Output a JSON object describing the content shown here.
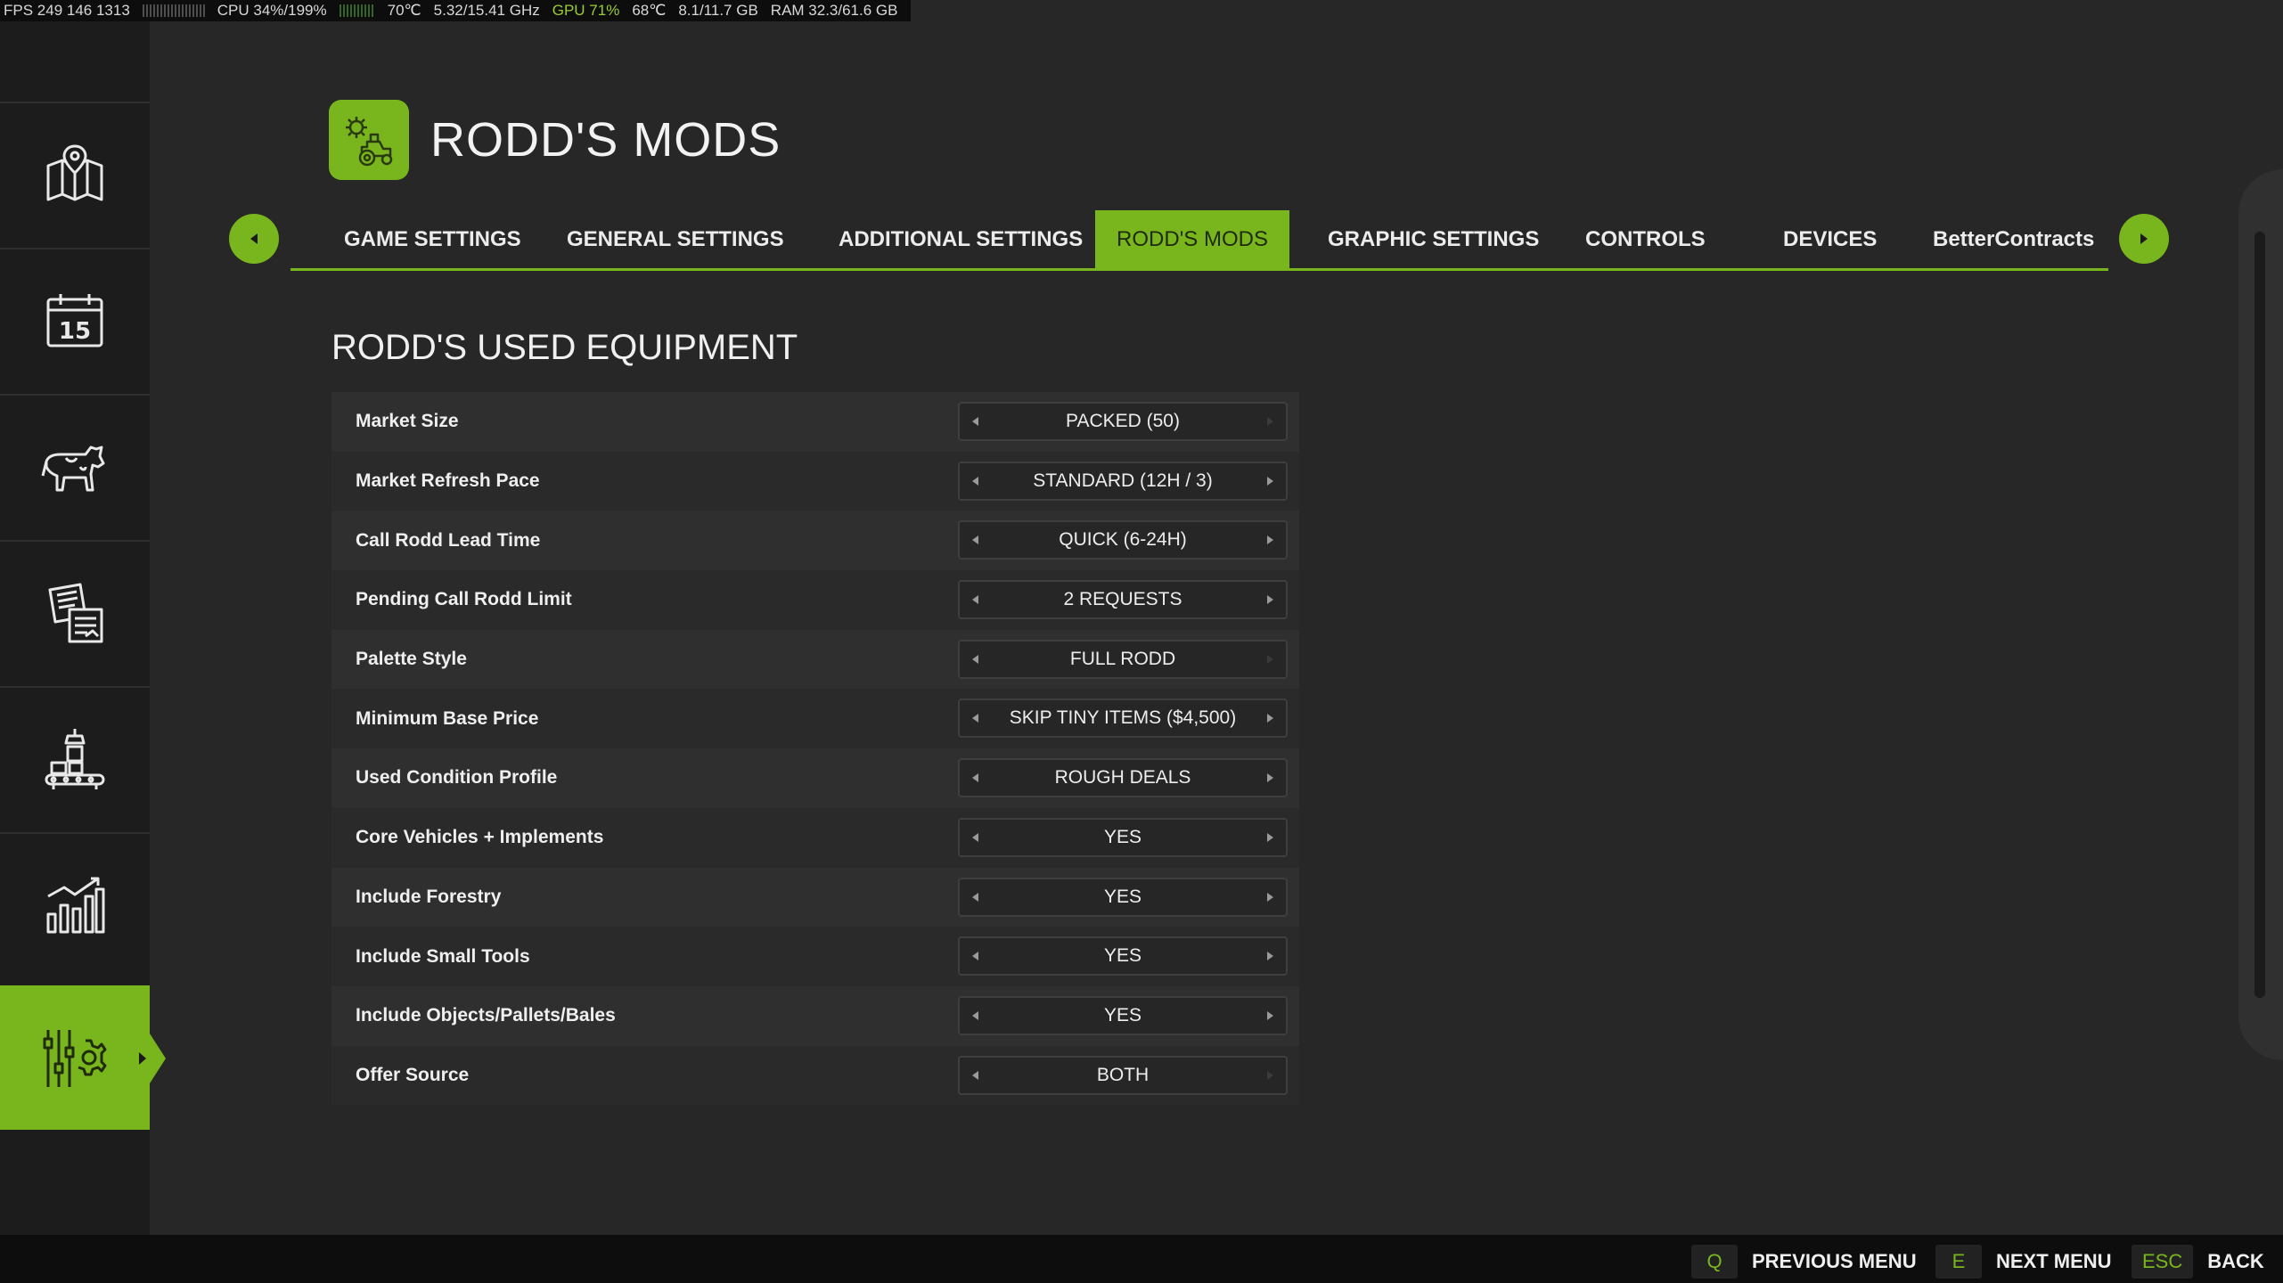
{
  "perf_overlay": {
    "fps": "FPS 249 146 1313",
    "cpu": "CPU 34%/199%",
    "cpu_temp": "70℃",
    "cpu_clock": "5.32/15.41 GHz",
    "gpu": "GPU 71%",
    "gpu_temp": "68℃",
    "vram": "8.1/11.7 GB",
    "ram": "RAM 32.3/61.6 GB"
  },
  "sidebar": {
    "items": [
      {
        "icon": "map-icon"
      },
      {
        "icon": "calendar-icon",
        "day": "15"
      },
      {
        "icon": "cow-icon"
      },
      {
        "icon": "contracts-icon"
      },
      {
        "icon": "production-icon"
      },
      {
        "icon": "statistics-icon"
      },
      {
        "icon": "settings-icon",
        "active": true
      }
    ]
  },
  "header": {
    "title": "RODD'S MODS",
    "logo_icon": "tractor-gear-icon"
  },
  "tabs": [
    {
      "label": "GAME SETTINGS"
    },
    {
      "label": "GENERAL SETTINGS"
    },
    {
      "label": "ADDITIONAL SETTINGS"
    },
    {
      "label": "RODD'S MODS",
      "active": true
    },
    {
      "label": "GRAPHIC SETTINGS"
    },
    {
      "label": "CONTROLS"
    },
    {
      "label": "DEVICES"
    },
    {
      "label": "BetterContracts"
    }
  ],
  "section": {
    "title": "RODD'S USED EQUIPMENT",
    "settings": [
      {
        "label": "Market Size",
        "value": "PACKED (50)",
        "right_enabled": false
      },
      {
        "label": "Market Refresh Pace",
        "value": "STANDARD (12H / 3)",
        "right_enabled": true
      },
      {
        "label": "Call Rodd Lead Time",
        "value": "QUICK (6-24H)",
        "right_enabled": true
      },
      {
        "label": "Pending Call Rodd Limit",
        "value": "2 REQUESTS",
        "right_enabled": true
      },
      {
        "label": "Palette Style",
        "value": "FULL RODD",
        "right_enabled": false
      },
      {
        "label": "Minimum Base Price",
        "value": "SKIP TINY ITEMS ($4,500)",
        "right_enabled": true
      },
      {
        "label": "Used Condition Profile",
        "value": "ROUGH DEALS",
        "right_enabled": true
      },
      {
        "label": "Core Vehicles + Implements",
        "value": "YES",
        "right_enabled": true
      },
      {
        "label": "Include Forestry",
        "value": "YES",
        "right_enabled": true
      },
      {
        "label": "Include Small Tools",
        "value": "YES",
        "right_enabled": true
      },
      {
        "label": "Include Objects/Pallets/Bales",
        "value": "YES",
        "right_enabled": true
      },
      {
        "label": "Offer Source",
        "value": "BOTH",
        "right_enabled": false
      }
    ]
  },
  "footer": {
    "hints": [
      {
        "key": "Q",
        "label": "PREVIOUS MENU"
      },
      {
        "key": "E",
        "label": "NEXT MENU"
      },
      {
        "key": "ESC",
        "label": "BACK"
      }
    ]
  },
  "colors": {
    "accent": "#79b51c",
    "background": "#272727",
    "sidebar": "#1c1c1c",
    "footer": "#0d0d0d"
  }
}
